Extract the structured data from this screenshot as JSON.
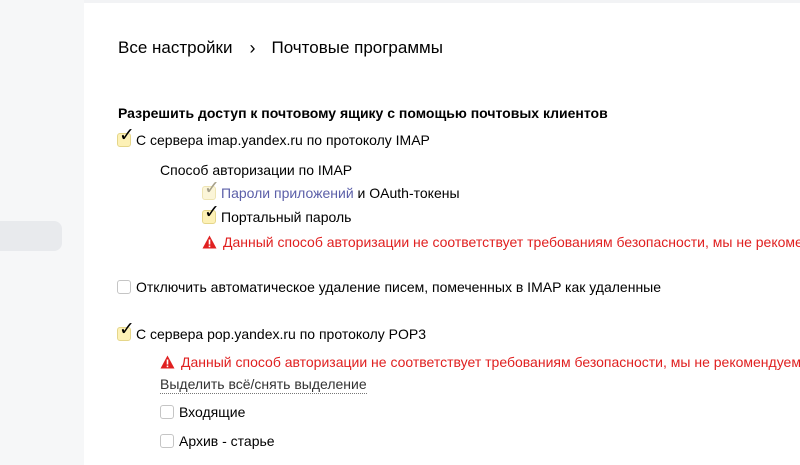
{
  "breadcrumb": {
    "root": "Все настройки",
    "separator": "›",
    "current": "Почтовые программы"
  },
  "section": {
    "title": "Разрешить доступ к почтовому ящику с помощью почтовых клиентов"
  },
  "imap": {
    "label": "С сервера imap.yandex.ru по протоколу IMAP",
    "checked": true,
    "auth_title": "Способ авторизации по IMAP",
    "app_passwords_link": "Пароли приложений",
    "app_passwords_suffix": " и OAuth-токены",
    "app_passwords_checked": true,
    "portal_password_label": "Портальный пароль",
    "portal_password_checked": true,
    "warning": "Данный способ авторизации не соответствует требованиям безопасности, мы не рекомен"
  },
  "auto_delete": {
    "label": "Отключить автоматическое удаление писем, помеченных в IMAP как удаленные",
    "checked": false
  },
  "pop3": {
    "label": "С сервера pop.yandex.ru по протоколу POP3",
    "checked": true,
    "warning": "Данный способ авторизации не соответствует требованиям безопасности, мы не рекомендуем е",
    "select_all": "Выделить всё/снять выделение",
    "folders": [
      {
        "label": "Входящие",
        "checked": false
      },
      {
        "label": "Архив - старье",
        "checked": false
      }
    ]
  },
  "icons": {
    "checkmark": "checkmark-icon",
    "warning": "warning-triangle-icon",
    "breadcrumb_separator": "chevron-right-icon"
  },
  "colors": {
    "warning": "#e02020",
    "link": "#5b5fa8",
    "checkbox_checked_bg": "#fdf1b6"
  }
}
